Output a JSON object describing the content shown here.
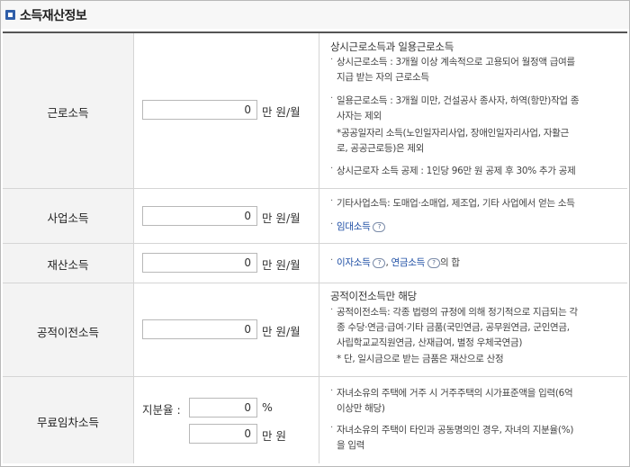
{
  "title": "소득재산정보",
  "rows": {
    "earned": {
      "label": "근로소득",
      "value": "0",
      "unit": "만 원/월",
      "heading": "상시근로소득과 일용근로소득",
      "l1": "상시근로소득 : 3개월 이상 계속적으로 고용되어 월정액 급여를",
      "l2": "지급 받는 자의 근로소득",
      "l3": "일용근로소득 : 3개월 미만, 건설공사 종사자, 하역(항만)작업 종",
      "l4": "사자는 제외",
      "l5": "*공공일자리 소득(노인일자리사업, 장애인일자리사업, 자활근",
      "l6": "로, 공공근로등)은 제외",
      "l7": "상시근로자 소득 공제 : 1인당 96만 원 공제 후 30% 추가 공제"
    },
    "business": {
      "label": "사업소득",
      "value": "0",
      "unit": "만 원/월",
      "l1": "기타사업소득: 도매업·소매업, 제조업, 기타 사업에서 얻는 소득",
      "link": "임대소득"
    },
    "property": {
      "label": "재산소득",
      "value": "0",
      "unit": "만 원/월",
      "link1": "이자소득",
      "sep": ", ",
      "link2": "연금소득",
      "suffix": "의 합"
    },
    "transfer": {
      "label": "공적이전소득",
      "value": "0",
      "unit": "만 원/월",
      "heading": "공적이전소득만 해당",
      "l1": "공적이전소득: 각종 법령의 규정에 의해 정기적으로 지급되는 각",
      "l2": "종 수당·연금·급여·기타 금품(국민연금, 공무원연금, 군인연금,",
      "l3": "사립학교교직원연금, 산재급여, 별정 우체국연금)",
      "l4": "* 단, 일시금으로 받는 금품은 재산으로 산정"
    },
    "rent": {
      "label": "무료임차소득",
      "share_label": "지분율 :",
      "share_value": "0",
      "share_unit": "%",
      "value": "0",
      "unit": "만 원",
      "l1": "자녀소유의 주택에 거주 시 거주주택의 시가표준액을 입력(6억",
      "l2": "이상만 해당)",
      "l3": "자녀소유의 주택이 타인과 공동명의인 경우, 자녀의 지분율(%)",
      "l4": "을 입력"
    }
  },
  "help_icon_glyph": "?",
  "colors": {
    "title_icon": "#2f5ea8",
    "link": "#1f4fa5",
    "label_bg": "#f3f3f3"
  }
}
